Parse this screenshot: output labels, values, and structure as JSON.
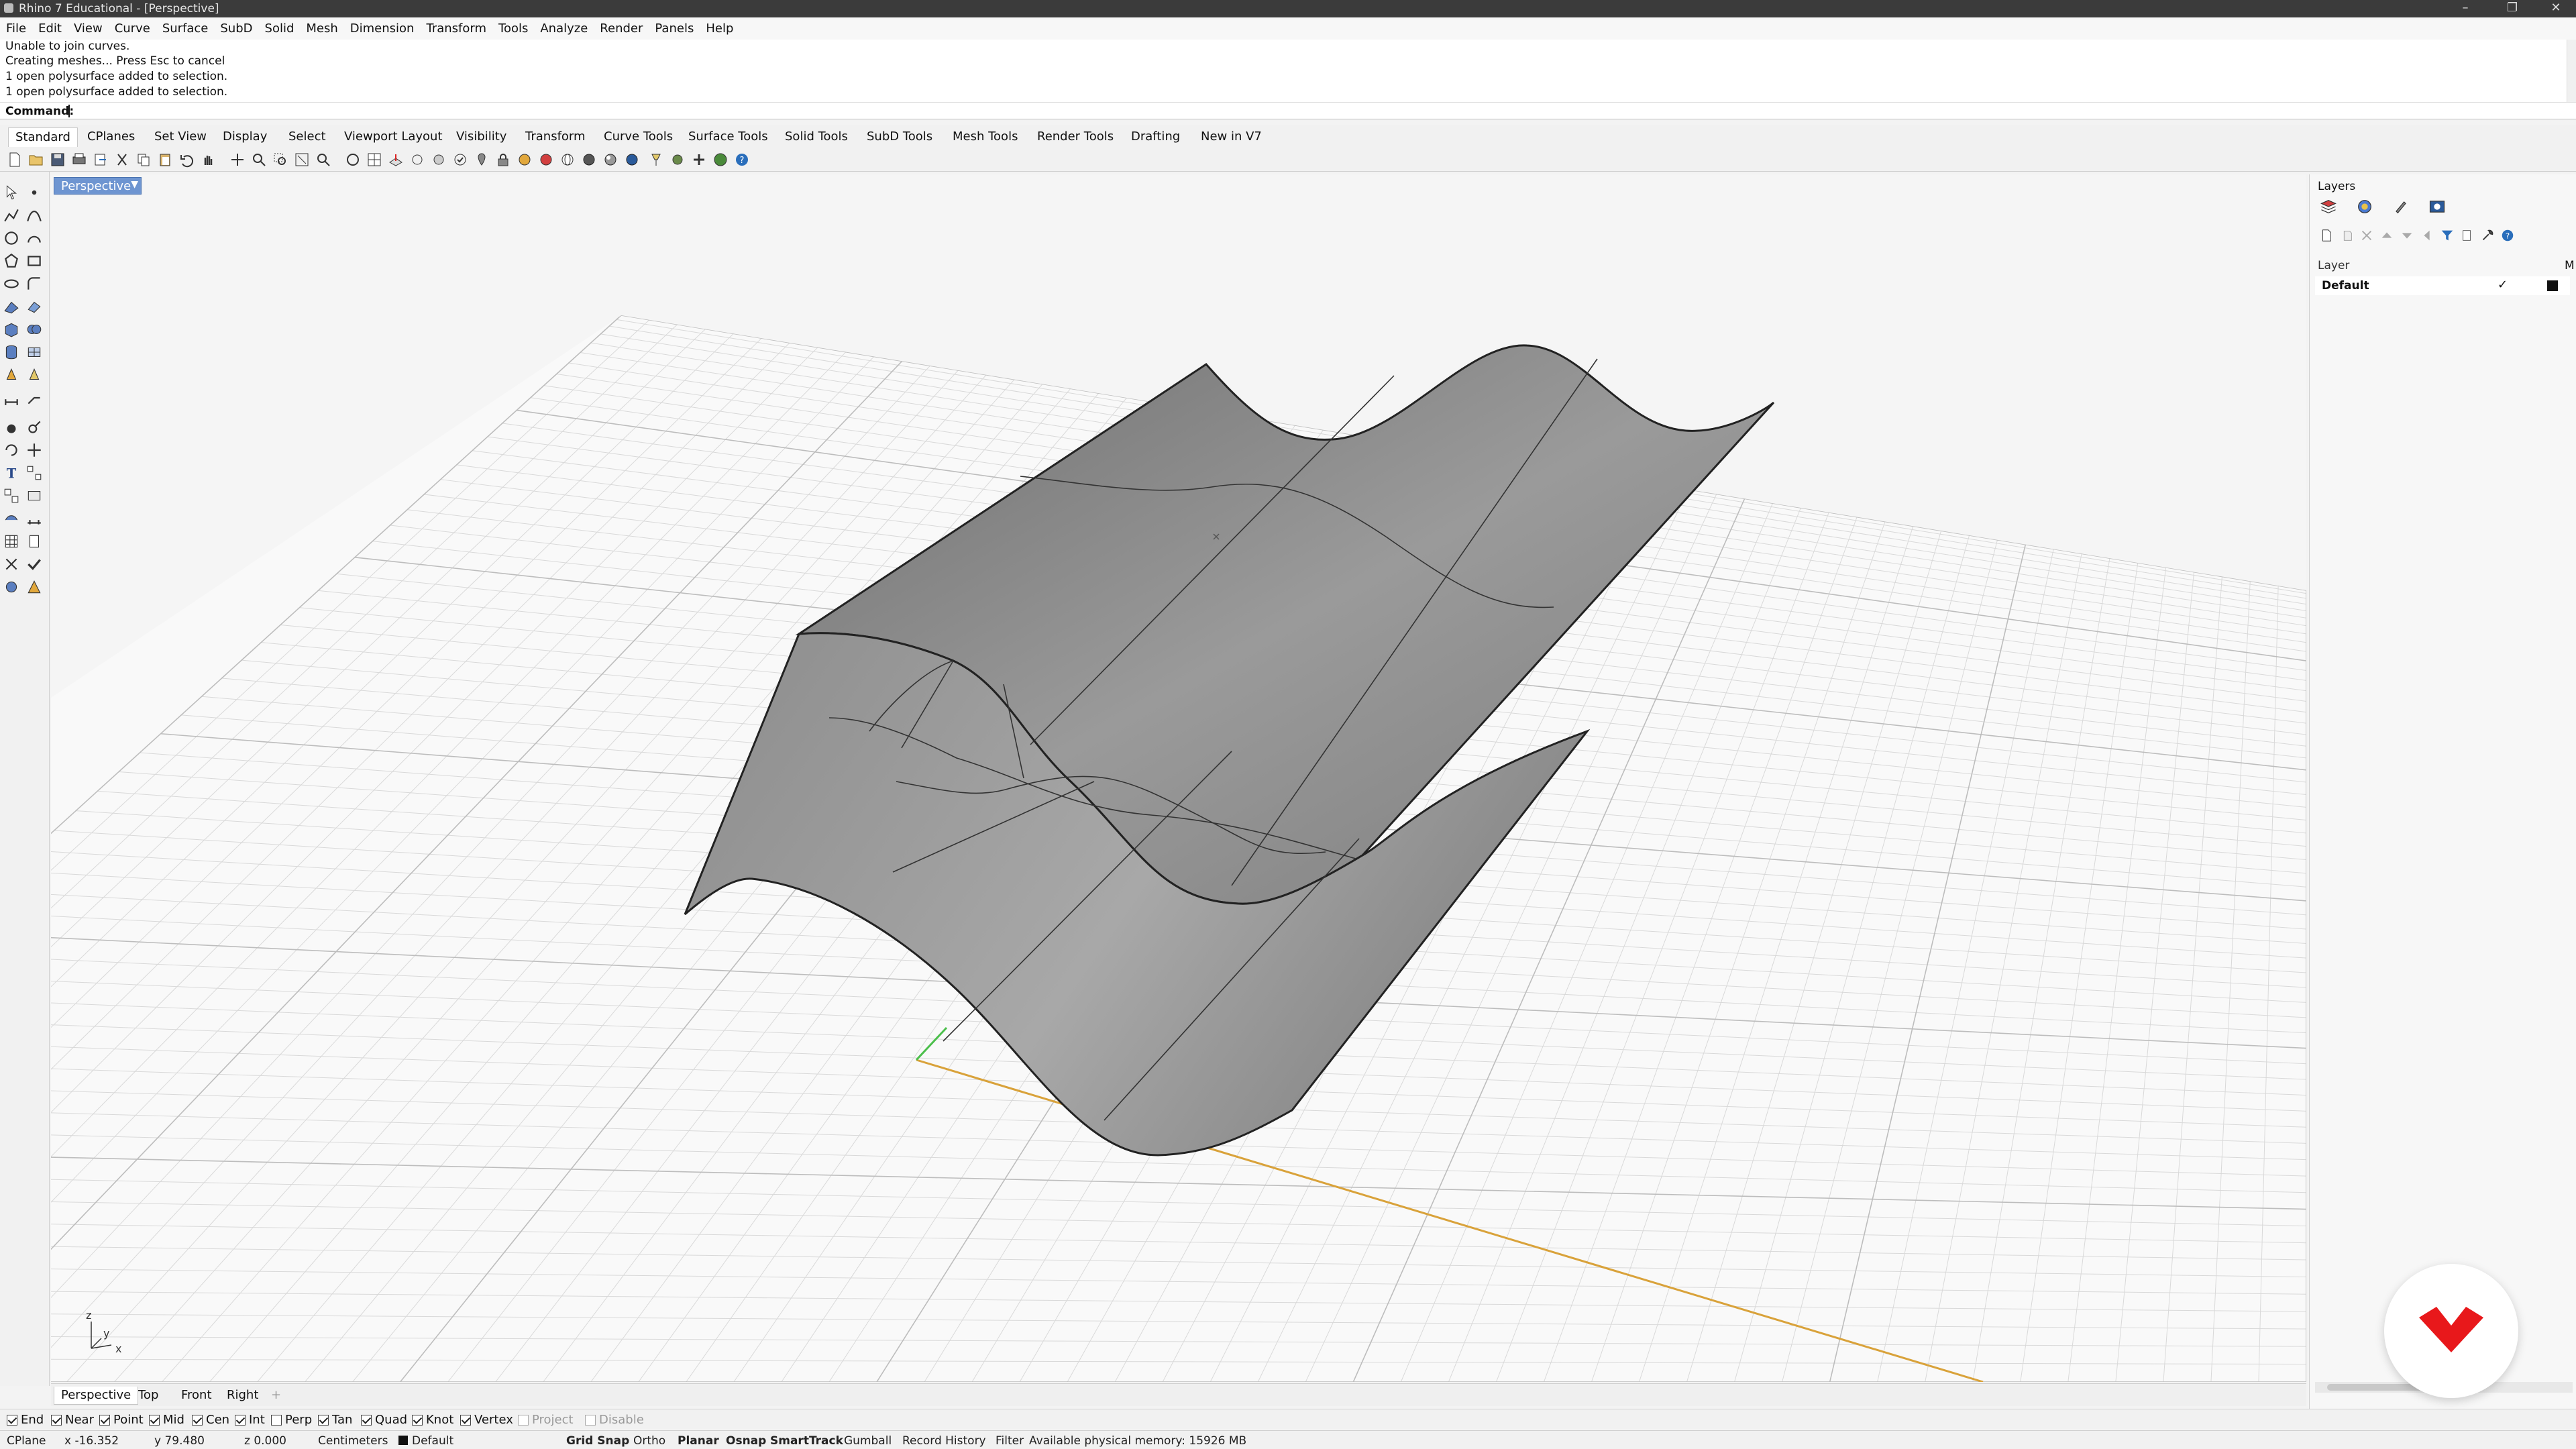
{
  "window": {
    "title": "Rhino 7 Educational - [Perspective]"
  },
  "menu": [
    "File",
    "Edit",
    "View",
    "Curve",
    "Surface",
    "SubD",
    "Solid",
    "Mesh",
    "Dimension",
    "Transform",
    "Tools",
    "Analyze",
    "Render",
    "Panels",
    "Help"
  ],
  "command_history": [
    "Unable to join curves.",
    "Creating meshes... Press Esc to cancel",
    "1 open polysurface added to selection.",
    "1 open polysurface added to selection."
  ],
  "command_prompt": "Command:",
  "toolbar_tabs": [
    "Standard",
    "CPlanes",
    "Set View",
    "Display",
    "Select",
    "Viewport Layout",
    "Visibility",
    "Transform",
    "Curve Tools",
    "Surface Tools",
    "Solid Tools",
    "SubD Tools",
    "Mesh Tools",
    "Render Tools",
    "Drafting",
    "New in V7"
  ],
  "viewport": {
    "active_label": "Perspective",
    "axis_labels": {
      "z": "z",
      "y": "y",
      "x": "x"
    }
  },
  "viewport_tabs": [
    "Perspective",
    "Top",
    "Front",
    "Right"
  ],
  "osnaps": [
    {
      "label": "End",
      "checked": true
    },
    {
      "label": "Near",
      "checked": true
    },
    {
      "label": "Point",
      "checked": true
    },
    {
      "label": "Mid",
      "checked": true
    },
    {
      "label": "Cen",
      "checked": true
    },
    {
      "label": "Int",
      "checked": true
    },
    {
      "label": "Perp",
      "checked": false
    },
    {
      "label": "Tan",
      "checked": true
    },
    {
      "label": "Quad",
      "checked": true
    },
    {
      "label": "Knot",
      "checked": true
    },
    {
      "label": "Vertex",
      "checked": true
    },
    {
      "label": "Project",
      "checked": false,
      "disabled": true
    },
    {
      "label": "Disable",
      "checked": false,
      "disabled": true
    }
  ],
  "status": {
    "cplane": "CPlane",
    "x": "x -16.352",
    "y": "y 79.480",
    "z": "z 0.000",
    "units": "Centimeters",
    "layer": "Default",
    "panes": [
      "Grid Snap",
      "Ortho",
      "Planar",
      "Osnap",
      "SmartTrack",
      "Gumball",
      "Record History",
      "Filter"
    ],
    "active_panes": [
      "Grid Snap",
      "Planar",
      "Osnap",
      "SmartTrack"
    ],
    "memory": "Available physical memory: 15926 MB"
  },
  "layers_panel": {
    "title": "Layers",
    "column_header": "Layer",
    "column_header_2": "M",
    "layers": [
      {
        "name": "Default",
        "current": true,
        "color": "#000000"
      }
    ]
  },
  "colors": {
    "viewport_tab": "#6e95d1",
    "x_axis": "#d9a23a",
    "y_axis": "#4bbf4b",
    "logo": "#e8181b",
    "surface": "#8a8a8a"
  }
}
